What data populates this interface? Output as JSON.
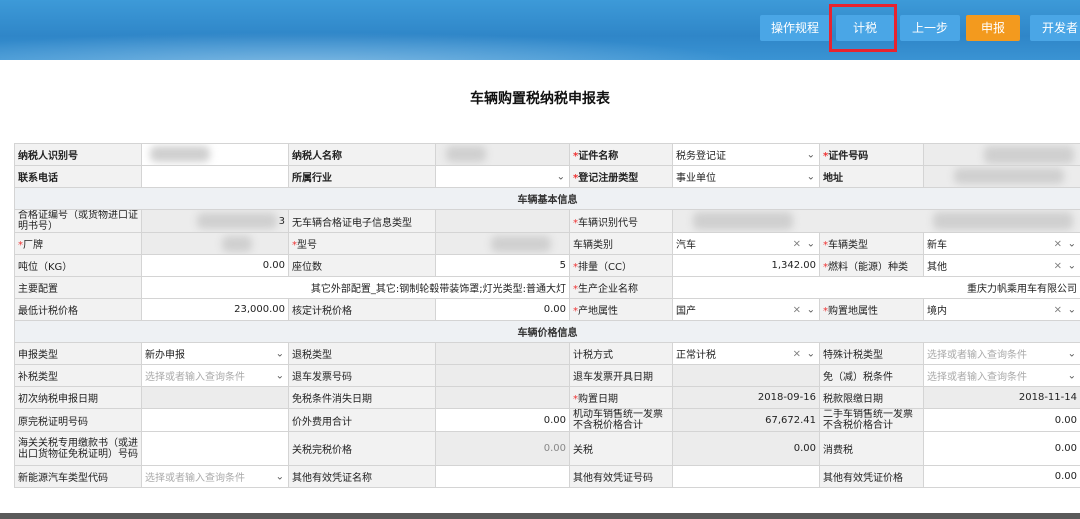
{
  "toolbar": {
    "btn_rules": "操作规程",
    "btn_calc": "计税",
    "btn_prev": "上一步",
    "btn_submit": "申报",
    "btn_dev": "开发者"
  },
  "page_title": "车辆购置税纳税申报表",
  "rows": {
    "r1": {
      "l1": "纳税人识别号",
      "l2": "纳税人名称",
      "l3": "证件名称",
      "v3": "税务登记证",
      "l4": "证件号码"
    },
    "r2": {
      "l1": "联系电话",
      "l2": "所属行业",
      "l3": "登记注册类型",
      "v3": "事业单位",
      "l4": "地址"
    },
    "sec1": "车辆基本信息",
    "r3": {
      "l1": "合格证编号（或货物进口证明书号）",
      "v1suffix": "3",
      "l2": "无车辆合格证电子信息类型",
      "l3": "车辆识别代号"
    },
    "r4": {
      "l1": "厂牌",
      "l2": "型号",
      "l3": "车辆类别",
      "v3": "汽车",
      "l4": "车辆类型",
      "v4": "新车"
    },
    "r5": {
      "l1": "吨位（KG）",
      "v1": "0.00",
      "l2": "座位数",
      "v2": "5",
      "l3": "排量（CC）",
      "v3": "1,342.00",
      "l4": "燃料（能源）种类",
      "v4": "其他"
    },
    "r6": {
      "l1": "主要配置",
      "v1": "其它外部配置_其它:钢制轮毂带装饰罩;灯光类型:普通大灯",
      "l2": "生产企业名称",
      "v2": "重庆力帆乘用车有限公司"
    },
    "r7": {
      "l1": "最低计税价格",
      "v1": "23,000.00",
      "l2": "核定计税价格",
      "v2": "0.00",
      "l3": "产地属性",
      "v3": "国产",
      "l4": "购置地属性",
      "v4": "境内"
    },
    "sec2": "车辆价格信息",
    "r8": {
      "l1": "申报类型",
      "v1": "新办申报",
      "l2": "退税类型",
      "l3": "计税方式",
      "v3": "正常计税",
      "l4": "特殊计税类型",
      "v4": "选择或者输入查询条件"
    },
    "r9": {
      "l1": "补税类型",
      "v1": "选择或者输入查询条件",
      "l2": "退车发票号码",
      "l3": "退车发票开具日期",
      "l4": "免（减）税条件",
      "v4": "选择或者输入查询条件"
    },
    "r10": {
      "l1": "初次纳税申报日期",
      "l2": "免税条件消失日期",
      "l3": "购置日期",
      "v3": "2018-09-16",
      "l4": "税款限缴日期",
      "v4": "2018-11-14"
    },
    "r11": {
      "l1": "原完税证明号码",
      "l2": "价外费用合计",
      "v2": "0.00",
      "l3": "机动车销售统一发票不含税价格合计",
      "v3": "67,672.41",
      "l4": "二手车销售统一发票不含税价格合计",
      "v4": "0.00"
    },
    "r12": {
      "l1": "海关关税专用缴款书（或进出口货物征免税证明）号码",
      "l2": "关税完税价格",
      "v2": "0.00",
      "l3": "关税",
      "v3": "0.00",
      "l4": "消费税",
      "v4": "0.00"
    },
    "r13": {
      "l1": "新能源汽车类型代码",
      "v1": "选择或者输入查询条件",
      "l2": "其他有效凭证名称",
      "l3": "其他有效凭证号码",
      "l4": "其他有效凭证价格",
      "v4": "0.00"
    }
  },
  "required_mark": "*",
  "icons": {
    "dropdown": "chevron-down-icon",
    "clear": "clear-x-icon"
  },
  "colors": {
    "header_blue": "#2f86c8",
    "submit_orange": "#f39a1e",
    "highlight_red": "#e8232f"
  }
}
